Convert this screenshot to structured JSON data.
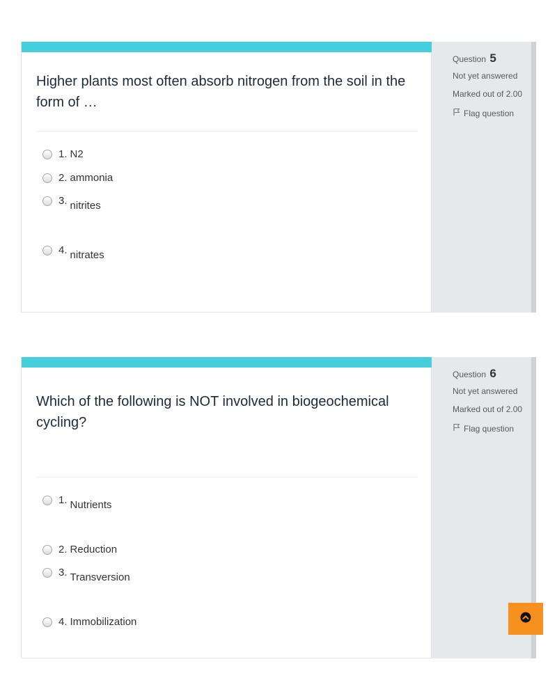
{
  "questions": [
    {
      "label": "Question",
      "number": "5",
      "state": "Not yet answered",
      "grade": "Marked out of 2.00",
      "flag": "Flag question",
      "text": "Higher plants most often absorb nitrogen from the soil in the form of …",
      "options": [
        {
          "num": "1.",
          "label": "N2"
        },
        {
          "num": "2.",
          "label": "ammonia"
        },
        {
          "num": "3.",
          "label": "nitrites"
        },
        {
          "num": "4.",
          "label": "nitrates"
        }
      ]
    },
    {
      "label": "Question",
      "number": "6",
      "state": "Not yet answered",
      "grade": "Marked out of 2.00",
      "flag": "Flag question",
      "text": "Which of the following is NOT involved in biogeochemical cycling?",
      "options": [
        {
          "num": "1.",
          "label": "Nutrients"
        },
        {
          "num": "2.",
          "label": "Reduction"
        },
        {
          "num": "3.",
          "label": "Transversion"
        },
        {
          "num": "4.",
          "label": "Immobilization"
        }
      ]
    }
  ],
  "colors": {
    "header_bar": "#45cfdc",
    "info_panel": "#e6e9ec",
    "back_to_top": "#f6901e"
  },
  "icons": {
    "flag": "flag-icon",
    "back_to_top": "chevron-up-circle-icon"
  }
}
